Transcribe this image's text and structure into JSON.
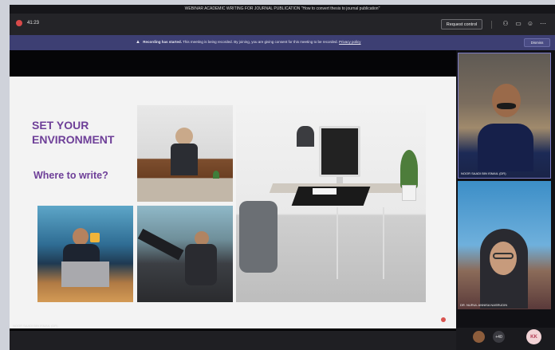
{
  "window": {
    "title": "WEBINAR ACADEMIC WRITING FOR JOURNAL PUBLICATION \"How to convert thesis to journal publication\""
  },
  "controlbar": {
    "timer": "41:23",
    "request_control_label": "Request control"
  },
  "banner": {
    "bold": "Recording has started.",
    "text": " This meeting is being recorded. By joining, you are giving consent for this meeting to be recorded.",
    "link": "Privacy policy",
    "dismiss_label": "Dismiss"
  },
  "slide": {
    "title": "SET YOUR ENVIRONMENT",
    "subtitle": "Where to write?"
  },
  "stage": {
    "presenter_label": "NOOR SAADI BIN ISMAIL (DR)"
  },
  "participants": [
    {
      "name": "NOOR SAADI BIN ISMAIL (DR)"
    },
    {
      "name": "DR. NURUL ANNISA NASRUDIN"
    }
  ],
  "bottombar": {
    "overflow_count": "+40",
    "user_initials": "KK"
  },
  "colors": {
    "accent": "#6e3f98",
    "banner": "#3d3f73"
  }
}
